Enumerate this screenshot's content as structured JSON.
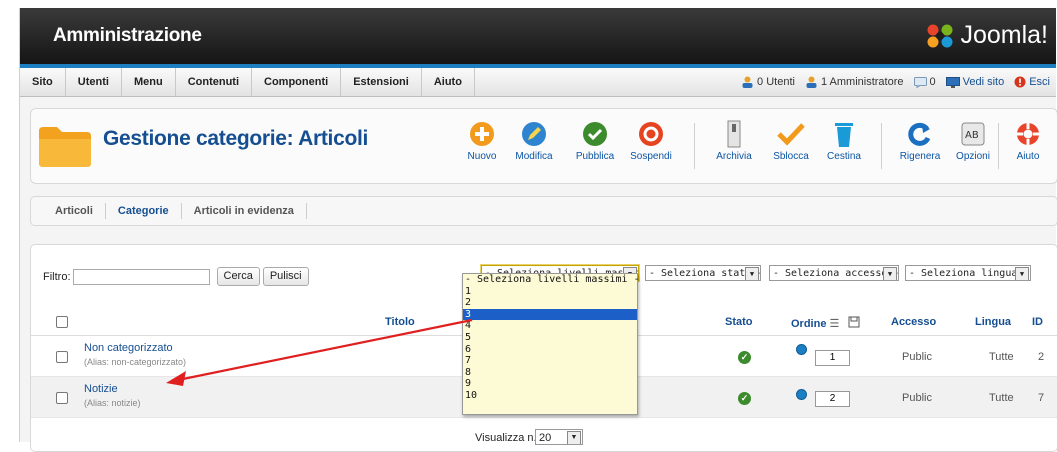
{
  "header": {
    "title": "Amministrazione",
    "brand": "Joomla!"
  },
  "menu": [
    "Sito",
    "Utenti",
    "Menu",
    "Contenuti",
    "Componenti",
    "Estensioni",
    "Aiuto"
  ],
  "status": {
    "users": "0 Utenti",
    "admins": "1 Amministratore",
    "messages": "0",
    "view_site": "Vedi sito",
    "logout": "Esci"
  },
  "page": {
    "title": "Gestione categorie: Articoli"
  },
  "toolbar": {
    "nuovo": "Nuovo",
    "modifica": "Modifica",
    "pubblica": "Pubblica",
    "sospendi": "Sospendi",
    "archivia": "Archivia",
    "sblocca": "Sblocca",
    "cestina": "Cestina",
    "rigenera": "Rigenera",
    "opzioni": "Opzioni",
    "aiuto": "Aiuto"
  },
  "subnav": [
    "Articoli",
    "Categorie",
    "Articoli in evidenza"
  ],
  "filter": {
    "label": "Filtro:",
    "value": "",
    "search": "Cerca",
    "clear": "Pulisci",
    "levels": "- Seleziona livelli massimi -",
    "state": "- Seleziona stato -",
    "access": "- Seleziona accesso -",
    "language": "- Seleziona lingua -"
  },
  "dropdown_options": [
    "- Seleziona livelli massimi -",
    "1",
    "2",
    "3",
    "4",
    "5",
    "6",
    "7",
    "8",
    "9",
    "10"
  ],
  "dropdown_selected": "3",
  "columns": {
    "title": "Titolo",
    "state": "Stato",
    "order": "Ordine",
    "access": "Accesso",
    "language": "Lingua",
    "id": "ID"
  },
  "rows": [
    {
      "title": "Non categorizzato",
      "alias": "(Alias: non-categorizzato)",
      "order": "1",
      "access": "Public",
      "language": "Tutte",
      "id": "2"
    },
    {
      "title": "Notizie",
      "alias": "(Alias: notizie)",
      "order": "2",
      "access": "Public",
      "language": "Tutte",
      "id": "7"
    }
  ],
  "footer": {
    "label": "Visualizza n.",
    "value": "20"
  },
  "colors": {
    "header_dark": "#1e1e1e",
    "accent_blue": "#1b7fc1",
    "title_blue": "#154e91",
    "annotation_red": "#e02020"
  }
}
